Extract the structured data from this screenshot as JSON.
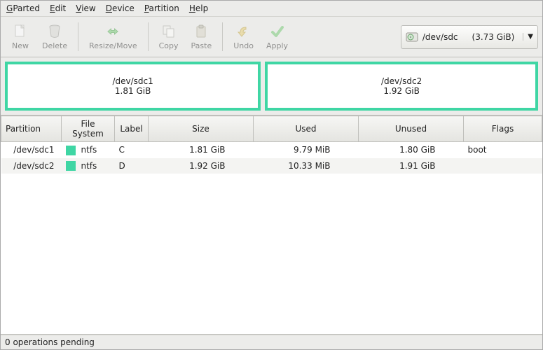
{
  "menu": {
    "gparted": "GParted",
    "edit": "Edit",
    "view": "View",
    "device": "Device",
    "partition": "Partition",
    "help": "Help"
  },
  "toolbar": {
    "new": "New",
    "delete": "Delete",
    "resize": "Resize/Move",
    "copy": "Copy",
    "paste": "Paste",
    "undo": "Undo",
    "apply": "Apply"
  },
  "device": {
    "name": "/dev/sdc",
    "size": "(3.73 GiB)"
  },
  "viz": {
    "p1_name": "/dev/sdc1",
    "p1_size": "1.81 GiB",
    "p2_name": "/dev/sdc2",
    "p2_size": "1.92 GiB"
  },
  "headers": {
    "partition": "Partition",
    "filesystem": "File System",
    "label": "Label",
    "size": "Size",
    "used": "Used",
    "unused": "Unused",
    "flags": "Flags"
  },
  "rows": [
    {
      "partition": "/dev/sdc1",
      "fs": "ntfs",
      "label": "C",
      "size": "1.81 GiB",
      "used": "9.79 MiB",
      "unused": "1.80 GiB",
      "flags": "boot"
    },
    {
      "partition": "/dev/sdc2",
      "fs": "ntfs",
      "label": "D",
      "size": "1.92 GiB",
      "used": "10.33 MiB",
      "unused": "1.91 GiB",
      "flags": ""
    }
  ],
  "status": "0 operations pending",
  "colors": {
    "ntfs": "#3fd6a4"
  }
}
